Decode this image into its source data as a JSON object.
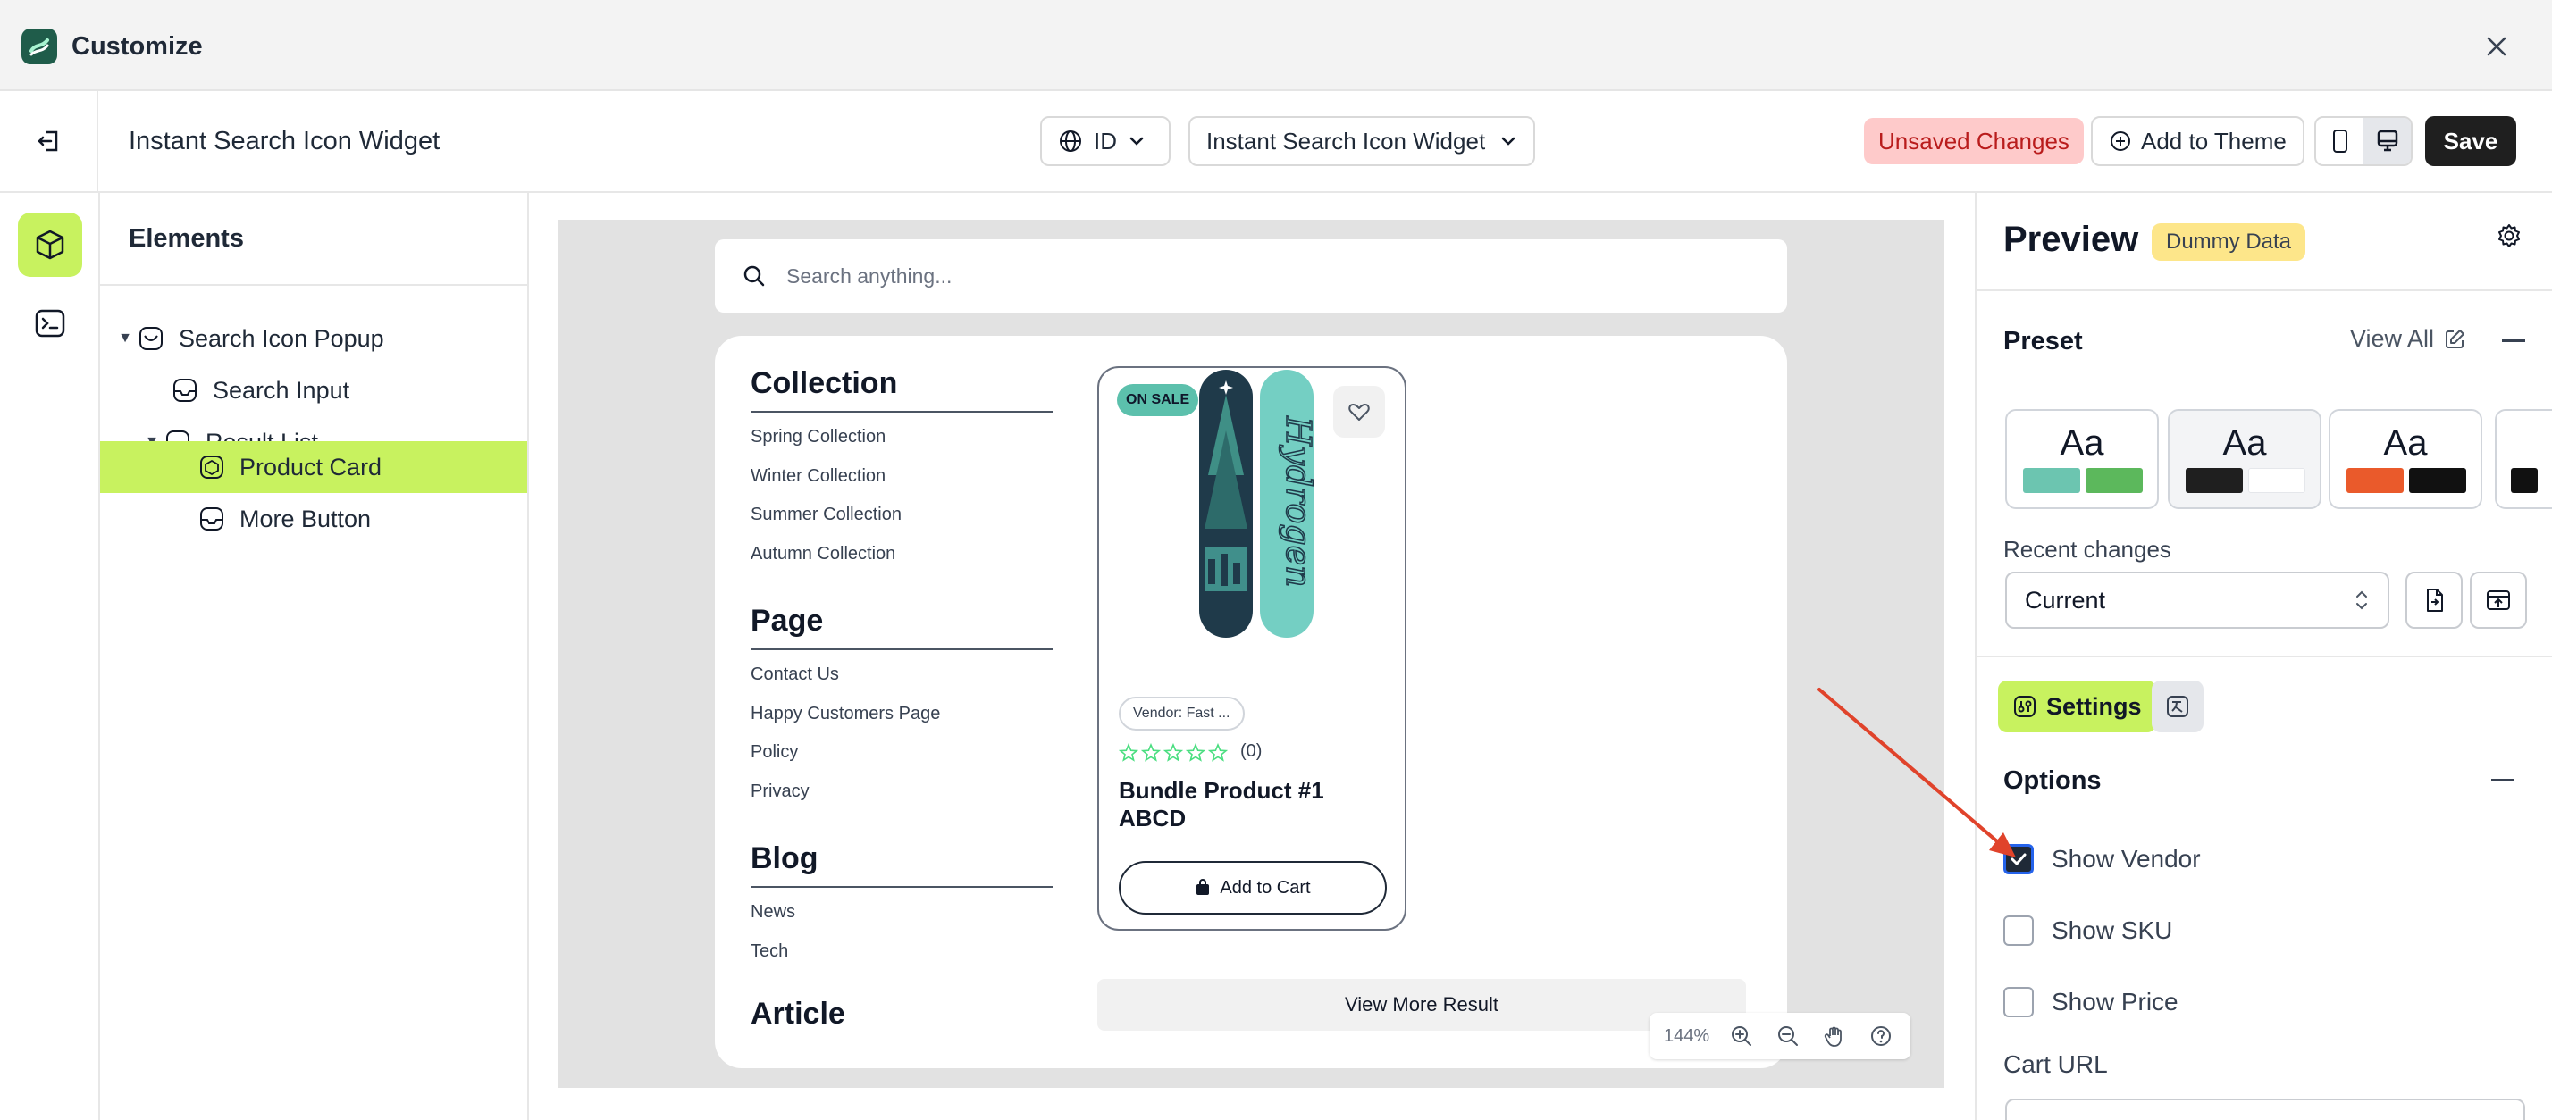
{
  "app": {
    "title": "Customize"
  },
  "toolbar": {
    "widget_title": "Instant Search Icon Widget",
    "language": "ID",
    "widget_select": "Instant Search Icon Widget",
    "unsaved": "Unsaved Changes",
    "add_to_theme": "Add to Theme",
    "save": "Save"
  },
  "elements": {
    "title": "Elements",
    "items": [
      {
        "label": "Search Icon Popup"
      },
      {
        "label": "Search Input"
      },
      {
        "label": "Result List"
      },
      {
        "label": "Product Card"
      },
      {
        "label": "More Button"
      }
    ]
  },
  "preview": {
    "search_placeholder": "Search anything...",
    "categories": [
      {
        "title": "Collection",
        "links": [
          "Spring Collection",
          "Winter Collection",
          "Summer Collection",
          "Autumn Collection"
        ]
      },
      {
        "title": "Page",
        "links": [
          "Contact Us",
          "Happy Customers Page",
          "Policy",
          "Privacy"
        ]
      },
      {
        "title": "Blog",
        "links": [
          "News",
          "Tech"
        ]
      },
      {
        "title": "Article",
        "links": []
      }
    ],
    "product": {
      "badge": "ON SALE",
      "vendor": "Vendor: Fast ...",
      "reviews": "(0)",
      "rating": 0,
      "rating_max": 5,
      "title": "Bundle Product #1 ABCD",
      "cart_label": "Add to Cart",
      "board_text": "Hydrogen"
    },
    "more_label": "View More Result",
    "zoom": "144%"
  },
  "right_panel": {
    "title": "Preview",
    "badge": "Dummy Data",
    "preset_label": "Preset",
    "view_all": "View All",
    "preset_glyph": "Aa",
    "presets": [
      {
        "c1": "#6cc5b0",
        "c2": "#5cb85c"
      },
      {
        "c1": "#1f1f1f",
        "c2": "#ffffff"
      },
      {
        "c1": "#ea5a2b",
        "c2": "#111111"
      }
    ],
    "recent_label": "Recent changes",
    "recent_value": "Current",
    "settings_tab": "Settings",
    "options_label": "Options",
    "options": [
      {
        "label": "Show Vendor",
        "checked": true
      },
      {
        "label": "Show SKU",
        "checked": false
      },
      {
        "label": "Show Price",
        "checked": false
      }
    ],
    "cart_url_label": "Cart URL"
  },
  "colors": {
    "accent": "#c8f25f",
    "arrow": "#e0432b",
    "save_bg": "#1f1f1f"
  }
}
